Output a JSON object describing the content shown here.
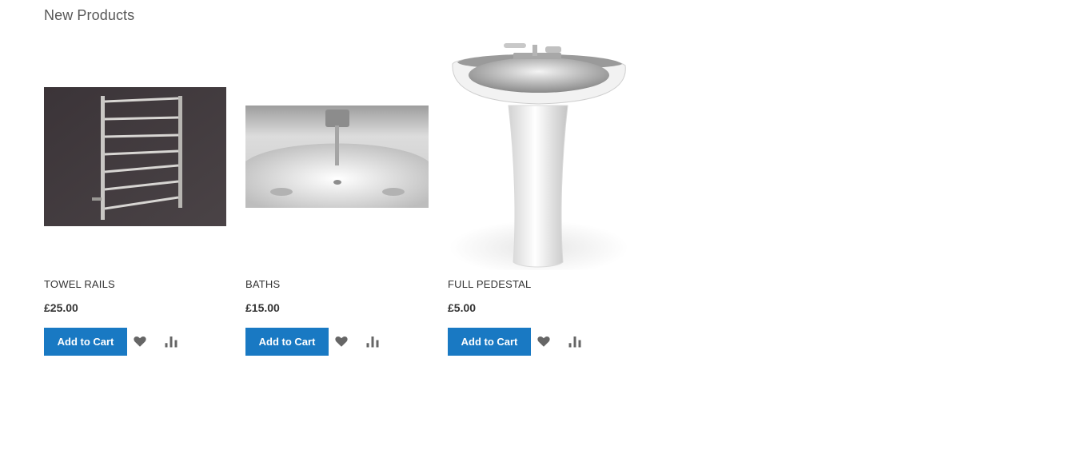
{
  "section": {
    "title": "New Products"
  },
  "products": [
    {
      "name": "TOWEL RAILS",
      "price": "£25.00",
      "add_to_cart": "Add to Cart",
      "image_subject": "towel-rail"
    },
    {
      "name": "BATHS",
      "price": "£15.00",
      "add_to_cart": "Add to Cart",
      "image_subject": "bath"
    },
    {
      "name": "FULL PEDESTAL",
      "price": "£5.00",
      "add_to_cart": "Add to Cart",
      "image_subject": "pedestal-sink"
    }
  ],
  "icons": {
    "wishlist": "heart-icon",
    "compare": "bar-chart-icon"
  },
  "colors": {
    "button": "#1979c3",
    "button_text": "#ffffff",
    "icon": "#666666"
  }
}
